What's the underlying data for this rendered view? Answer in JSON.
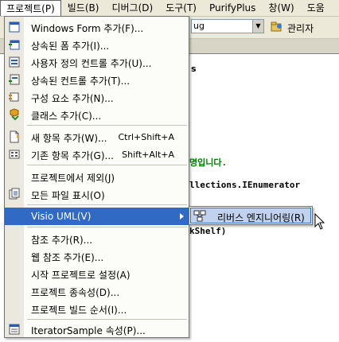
{
  "menubar": {
    "items": [
      {
        "label": "프로젝트(P)",
        "active": true
      },
      {
        "label": "빌드(B)"
      },
      {
        "label": "디버그(D)"
      },
      {
        "label": "도구(T)"
      },
      {
        "label": "PurifyPlus"
      },
      {
        "label": "창(W)"
      },
      {
        "label": "도움"
      }
    ]
  },
  "toolbar": {
    "config_value": "ug",
    "user_label": "관리자"
  },
  "background": {
    "tab_fragment": "s",
    "code_lines": [
      {
        "text": "명입니다.",
        "color": "#008000"
      },
      {
        "text": "llections.IEnumerator",
        "color": "#000000"
      },
      {
        "text": "kShelf)",
        "color": "#000000"
      }
    ]
  },
  "menu": {
    "items": [
      {
        "label": "Windows Form 추가(F)...",
        "icon": "windows-form-icon"
      },
      {
        "label": "상속된 폼 추가(I)...",
        "icon": "inherited-form-icon"
      },
      {
        "label": "사용자 정의 컨트롤 추가(U)...",
        "icon": "user-control-icon"
      },
      {
        "label": "상속된 컨트롤 추가(T)...",
        "icon": "inherited-control-icon"
      },
      {
        "label": "구성 요소 추가(N)...",
        "icon": "component-icon"
      },
      {
        "label": "클래스 추가(C)...",
        "icon": "class-icon"
      },
      {
        "label": "새 항목 추가(W)...",
        "shortcut": "Ctrl+Shift+A",
        "icon": "new-item-icon"
      },
      {
        "label": "기존 항목 추가(G)...",
        "shortcut": "Shift+Alt+A",
        "icon": "existing-item-icon"
      },
      {
        "label": "프로젝트에서 제외(J)"
      },
      {
        "label": "모든 파일 표시(O)",
        "icon": "show-all-files-icon"
      },
      {
        "label": "Visio UML(V)",
        "submenu": true
      },
      {
        "label": "참조 추가(R)..."
      },
      {
        "label": "웹 참조 추가(E)..."
      },
      {
        "label": "시작 프로젝트로 설정(A)"
      },
      {
        "label": "프로젝트 종속성(D)..."
      },
      {
        "label": "프로젝트 빌드 순서(I)..."
      },
      {
        "label": "IteratorSample 속성(P)...",
        "icon": "properties-icon"
      }
    ]
  },
  "submenu": {
    "items": [
      {
        "label": "리버스 엔지니어링(R)",
        "icon": "reverse-engineer-icon"
      }
    ]
  },
  "colors": {
    "menubar_bg": "#ece9d8",
    "selection": "#316ac5",
    "submenu_highlight": "#c1d2ee",
    "code_green": "#008000"
  }
}
